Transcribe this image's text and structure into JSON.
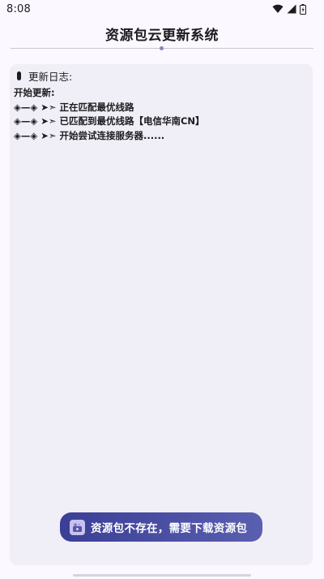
{
  "status_bar": {
    "time": "8:08"
  },
  "header": {
    "title": "资源包云更新系统"
  },
  "log": {
    "header_label": "更新日志:",
    "lines": [
      "开始更新:",
      "◈—◈ ➤➣ 正在匹配最优线路",
      "◈—◈ ➤➣ 已匹配到最优线路【电信华南CN】",
      "◈—◈ ➤➣ 开始尝试连接服务器......"
    ]
  },
  "toast": {
    "message": "资源包不存在，需要下载资源包",
    "icon": "app-icon"
  },
  "colors": {
    "background": "#fcf8ff",
    "panel": "#f0eef6",
    "toast_start": "#3a3e96",
    "toast_end": "#5b5fb0",
    "accent_dot": "#8a84b8"
  }
}
